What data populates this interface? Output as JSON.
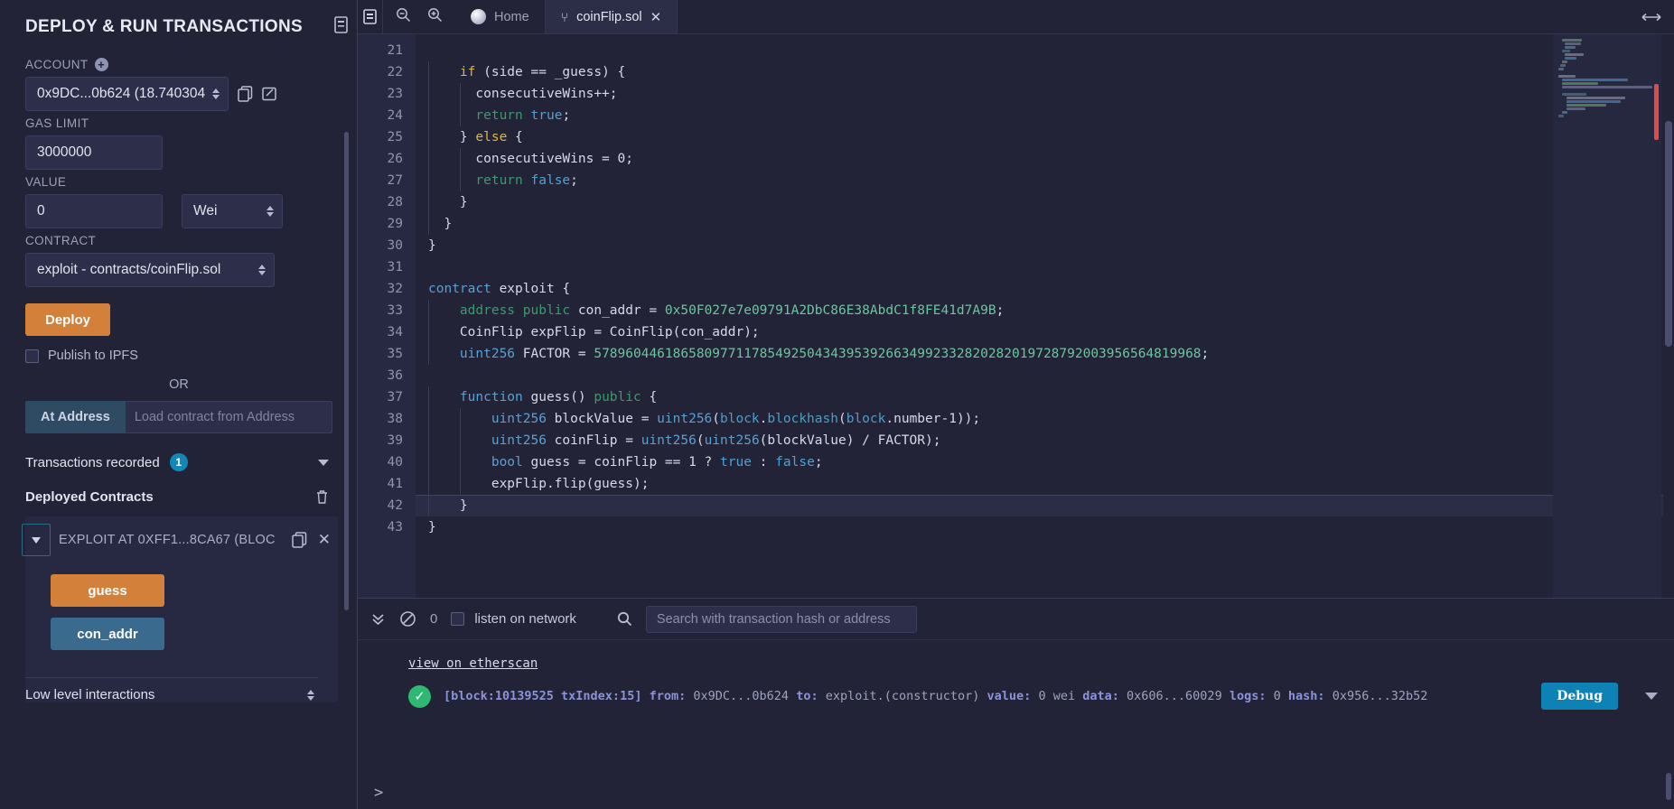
{
  "sidebar": {
    "title": "DEPLOY & RUN TRANSACTIONS",
    "doc_icon": "document-icon",
    "account": {
      "label": "ACCOUNT",
      "add_icon": "plus-circle-icon",
      "value": "0x9DC...0b624 (18.740304",
      "copy_icon": "copy-icon",
      "edit_icon": "edit-icon"
    },
    "gas_limit": {
      "label": "GAS LIMIT",
      "value": "3000000"
    },
    "value": {
      "label": "VALUE",
      "amount": "0",
      "unit": "Wei"
    },
    "contract": {
      "label": "CONTRACT",
      "value": "exploit - contracts/coinFlip.sol"
    },
    "deploy_button": "Deploy",
    "publish_ipfs": "Publish to IPFS",
    "or": "OR",
    "at_address_button": "At Address",
    "at_address_placeholder": "Load contract from Address",
    "transactions_recorded": {
      "label": "Transactions recorded",
      "count": "1"
    },
    "deployed_contracts": {
      "label": "Deployed Contracts",
      "trash_icon": "trash-icon"
    },
    "instance": {
      "title": "EXPLOIT AT 0XFF1...8CA67 (BLOC",
      "copy_icon": "copy-icon",
      "close_icon": "close-icon",
      "functions": [
        {
          "label": "guess",
          "style": "orange"
        },
        {
          "label": "con_addr",
          "style": "blue"
        }
      ]
    },
    "low_level": "Low level interactions"
  },
  "tabbar": {
    "panel_icon": "panel-toggle-icon",
    "zoom_out_icon": "zoom-out-icon",
    "zoom_in_icon": "zoom-in-icon",
    "expand_icon": "expand-horizontal-icon",
    "tabs": [
      {
        "label": "Home",
        "icon": "remix-globe-icon",
        "active": false,
        "closable": false
      },
      {
        "label": "coinFlip.sol",
        "icon": "solidity-icon",
        "active": true,
        "closable": true
      }
    ]
  },
  "editor": {
    "first_line_number": 21,
    "cursor_line": 42,
    "lines": [
      {
        "n": 21,
        "tokens": []
      },
      {
        "n": 22,
        "indent": 1,
        "tokens": [
          {
            "t": "    ",
            "c": "pl"
          },
          {
            "t": "if",
            "c": "kw"
          },
          {
            "t": " (side == _guess) {",
            "c": "pl"
          }
        ]
      },
      {
        "n": 23,
        "indent": 2,
        "tokens": [
          {
            "t": "      consecutiveWins++;",
            "c": "pl"
          }
        ]
      },
      {
        "n": 24,
        "indent": 2,
        "tokens": [
          {
            "t": "      ",
            "c": "pl"
          },
          {
            "t": "return",
            "c": "kw2"
          },
          {
            "t": " ",
            "c": "pl"
          },
          {
            "t": "true",
            "c": "lit"
          },
          {
            "t": ";",
            "c": "pl"
          }
        ]
      },
      {
        "n": 25,
        "indent": 1,
        "tokens": [
          {
            "t": "    } ",
            "c": "pl"
          },
          {
            "t": "else",
            "c": "kw"
          },
          {
            "t": " {",
            "c": "pl"
          }
        ]
      },
      {
        "n": 26,
        "indent": 2,
        "tokens": [
          {
            "t": "      consecutiveWins = ",
            "c": "pl"
          },
          {
            "t": "0",
            "c": "pl"
          },
          {
            "t": ";",
            "c": "pl"
          }
        ]
      },
      {
        "n": 27,
        "indent": 2,
        "tokens": [
          {
            "t": "      ",
            "c": "pl"
          },
          {
            "t": "return",
            "c": "kw2"
          },
          {
            "t": " ",
            "c": "pl"
          },
          {
            "t": "false",
            "c": "lit"
          },
          {
            "t": ";",
            "c": "pl"
          }
        ]
      },
      {
        "n": 28,
        "indent": 1,
        "tokens": [
          {
            "t": "    }",
            "c": "pl"
          }
        ]
      },
      {
        "n": 29,
        "indent": 1,
        "tokens": [
          {
            "t": "  }",
            "c": "pl"
          }
        ]
      },
      {
        "n": 30,
        "tokens": [
          {
            "t": "}",
            "c": "pl"
          }
        ]
      },
      {
        "n": 31,
        "tokens": []
      },
      {
        "n": 32,
        "tokens": [
          {
            "t": "contract",
            "c": "typ"
          },
          {
            "t": " exploit {",
            "c": "pl"
          }
        ]
      },
      {
        "n": 33,
        "indent": 1,
        "tokens": [
          {
            "t": "    ",
            "c": "pl"
          },
          {
            "t": "address",
            "c": "kw2"
          },
          {
            "t": " ",
            "c": "pl"
          },
          {
            "t": "public",
            "c": "kw2"
          },
          {
            "t": " con_addr = ",
            "c": "pl"
          },
          {
            "t": "0x50F027e7e09791A2DbC86E38AbdC1f8FE41d7A9B",
            "c": "str"
          },
          {
            "t": ";",
            "c": "pl"
          }
        ]
      },
      {
        "n": 34,
        "indent": 1,
        "tokens": [
          {
            "t": "    CoinFlip expFlip = CoinFlip(con_addr);",
            "c": "pl"
          }
        ]
      },
      {
        "n": 35,
        "indent": 1,
        "tokens": [
          {
            "t": "    ",
            "c": "pl"
          },
          {
            "t": "uint256",
            "c": "typ"
          },
          {
            "t": " FACTOR = ",
            "c": "pl"
          },
          {
            "t": "57896044618658097711785492504343953926634992332820282019728792003956564819968",
            "c": "str"
          },
          {
            "t": ";",
            "c": "pl"
          }
        ]
      },
      {
        "n": 36,
        "tokens": []
      },
      {
        "n": 37,
        "indent": 1,
        "tokens": [
          {
            "t": "    ",
            "c": "pl"
          },
          {
            "t": "function",
            "c": "typ"
          },
          {
            "t": " guess() ",
            "c": "pl"
          },
          {
            "t": "public",
            "c": "kw2"
          },
          {
            "t": " {",
            "c": "pl"
          }
        ]
      },
      {
        "n": 38,
        "indent": 2,
        "tokens": [
          {
            "t": "        ",
            "c": "pl"
          },
          {
            "t": "uint256",
            "c": "typ"
          },
          {
            "t": " blockValue = ",
            "c": "pl"
          },
          {
            "t": "uint256",
            "c": "typ"
          },
          {
            "t": "(",
            "c": "pl"
          },
          {
            "t": "block",
            "c": "glob"
          },
          {
            "t": ".",
            "c": "pl"
          },
          {
            "t": "blockhash",
            "c": "glob"
          },
          {
            "t": "(",
            "c": "pl"
          },
          {
            "t": "block",
            "c": "glob"
          },
          {
            "t": ".number-1));",
            "c": "pl"
          }
        ]
      },
      {
        "n": 39,
        "indent": 2,
        "tokens": [
          {
            "t": "        ",
            "c": "pl"
          },
          {
            "t": "uint256",
            "c": "typ"
          },
          {
            "t": " coinFlip = ",
            "c": "pl"
          },
          {
            "t": "uint256",
            "c": "typ"
          },
          {
            "t": "(",
            "c": "pl"
          },
          {
            "t": "uint256",
            "c": "typ"
          },
          {
            "t": "(blockValue) / FACTOR);",
            "c": "pl"
          }
        ]
      },
      {
        "n": 40,
        "indent": 2,
        "tokens": [
          {
            "t": "        ",
            "c": "pl"
          },
          {
            "t": "bool",
            "c": "typ"
          },
          {
            "t": " guess = coinFlip == ",
            "c": "pl"
          },
          {
            "t": "1",
            "c": "pl"
          },
          {
            "t": " ? ",
            "c": "pl"
          },
          {
            "t": "true",
            "c": "lit"
          },
          {
            "t": " : ",
            "c": "pl"
          },
          {
            "t": "false",
            "c": "lit"
          },
          {
            "t": ";",
            "c": "pl"
          }
        ]
      },
      {
        "n": 41,
        "indent": 2,
        "tokens": [
          {
            "t": "        expFlip.flip(guess);",
            "c": "pl"
          }
        ]
      },
      {
        "n": 42,
        "indent": 1,
        "tokens": [
          {
            "t": "    }",
            "c": "pl"
          }
        ]
      },
      {
        "n": 43,
        "tokens": [
          {
            "t": "}",
            "c": "pl"
          }
        ]
      }
    ]
  },
  "terminal": {
    "collapse_icon": "double-chevron-down-icon",
    "clear_icon": "no-entry-icon",
    "pending_count": "0",
    "listen_label": "listen on network",
    "search_icon": "search-icon",
    "search_placeholder": "Search with transaction hash or address",
    "etherscan_link": "view on etherscan",
    "transaction": {
      "status_icon": "check-circle-icon",
      "block_label": "[block:10139525 txIndex:15]",
      "from_label": "from:",
      "from_value": "0x9DC...0b624",
      "to_label": "to:",
      "to_value": "exploit.(constructor)",
      "value_label": "value:",
      "value_value": "0 wei",
      "data_label": "data:",
      "data_value": "0x606...60029",
      "logs_label": "logs:",
      "logs_value": "0",
      "hash_label": "hash:",
      "hash_value": "0x956...32b52",
      "debug_button": "Debug",
      "expand_icon": "chevron-down-icon"
    },
    "prompt": ">"
  },
  "colors": {
    "accent_orange": "#d2803a",
    "accent_blue": "#3b6a8f",
    "debug_blue": "#0f82b5",
    "badge_blue": "#1287b8",
    "success_green": "#2eb872",
    "bg": "#222336",
    "panel": "#2d2f4a"
  }
}
